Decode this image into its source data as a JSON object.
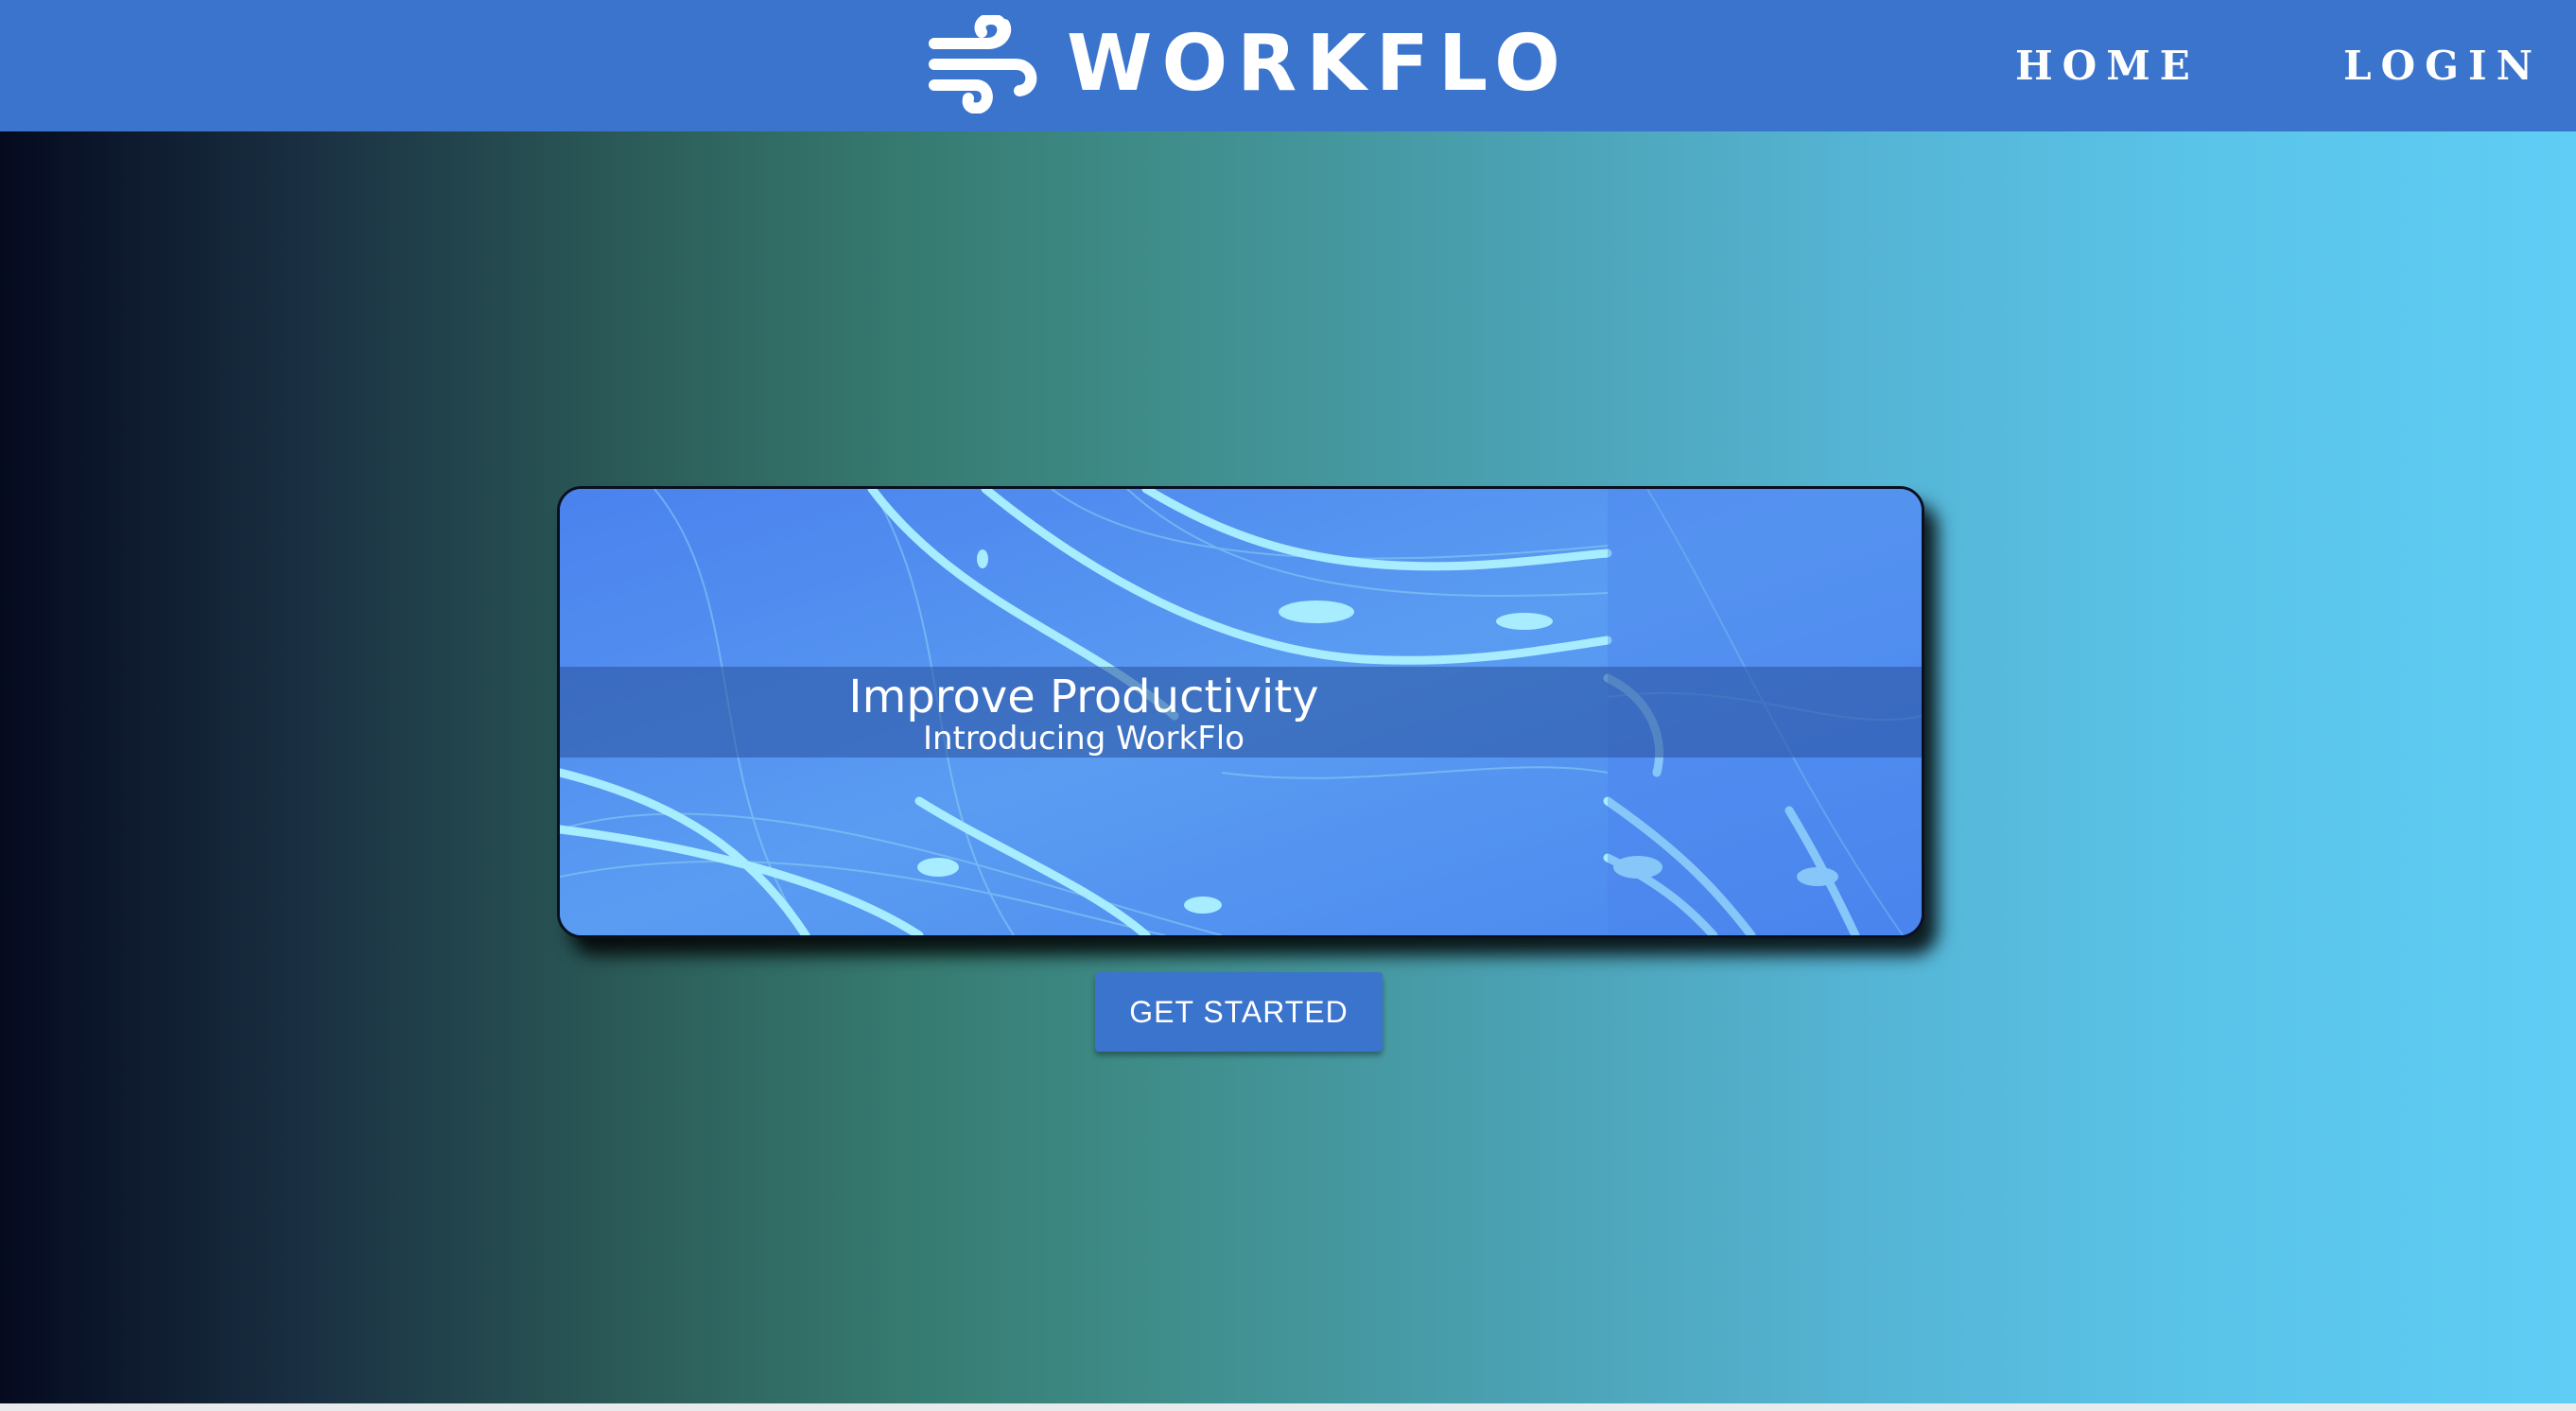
{
  "header": {
    "brand_name": "WORKFLO",
    "brand_icon": "wind-icon",
    "nav": [
      {
        "label": "HOME"
      },
      {
        "label": "LOGIN"
      }
    ],
    "background_color": "#3a74cc"
  },
  "banner": {
    "title": "Improve Productivity",
    "subtitle": "Introducing WorkFlo"
  },
  "cta": {
    "label": "GET STARTED"
  }
}
